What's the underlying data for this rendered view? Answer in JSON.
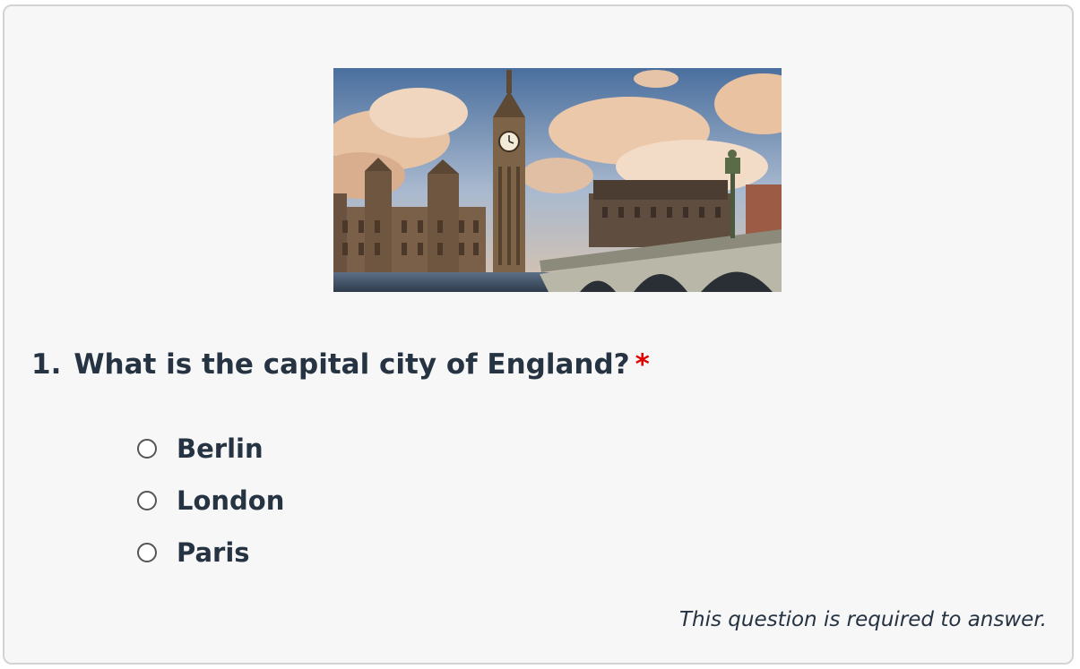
{
  "question": {
    "number": "1.",
    "text": "What is the capital city of England?",
    "required_marker": "*",
    "required_color": "#e00000",
    "image_subject": "Big Ben and Westminster Bridge, London",
    "options": [
      {
        "label": "Berlin",
        "selected": false
      },
      {
        "label": "London",
        "selected": false
      },
      {
        "label": "Paris",
        "selected": false
      }
    ],
    "required_note": "This question is required to answer."
  }
}
